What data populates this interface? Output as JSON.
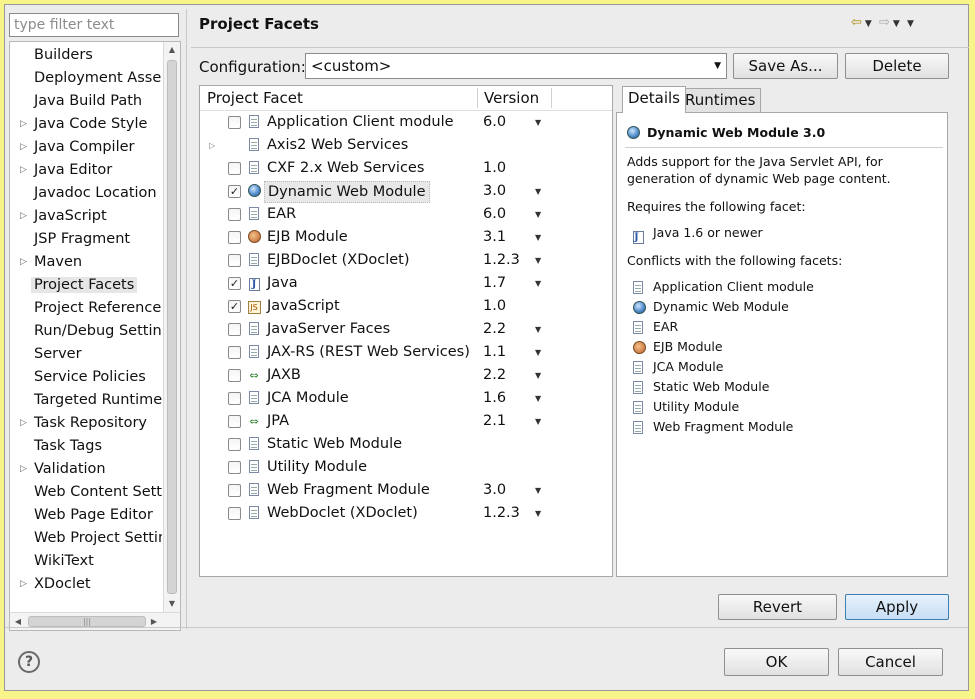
{
  "filter": {
    "placeholder": "type filter text"
  },
  "tree": {
    "items": [
      {
        "label": "Builders",
        "expandable": false
      },
      {
        "label": "Deployment Assembly",
        "expandable": false
      },
      {
        "label": "Java Build Path",
        "expandable": false
      },
      {
        "label": "Java Code Style",
        "expandable": true
      },
      {
        "label": "Java Compiler",
        "expandable": true
      },
      {
        "label": "Java Editor",
        "expandable": true
      },
      {
        "label": "Javadoc Location",
        "expandable": false
      },
      {
        "label": "JavaScript",
        "expandable": true
      },
      {
        "label": "JSP Fragment",
        "expandable": false
      },
      {
        "label": "Maven",
        "expandable": true
      },
      {
        "label": "Project Facets",
        "expandable": false,
        "selected": true
      },
      {
        "label": "Project References",
        "expandable": false
      },
      {
        "label": "Run/Debug Settings",
        "expandable": false
      },
      {
        "label": "Server",
        "expandable": false
      },
      {
        "label": "Service Policies",
        "expandable": false
      },
      {
        "label": "Targeted Runtimes",
        "expandable": false
      },
      {
        "label": "Task Repository",
        "expandable": true
      },
      {
        "label": "Task Tags",
        "expandable": false
      },
      {
        "label": "Validation",
        "expandable": true
      },
      {
        "label": "Web Content Settings",
        "expandable": false
      },
      {
        "label": "Web Page Editor",
        "expandable": false
      },
      {
        "label": "Web Project Settings",
        "expandable": false
      },
      {
        "label": "WikiText",
        "expandable": false
      },
      {
        "label": "XDoclet",
        "expandable": true
      }
    ]
  },
  "page": {
    "title": "Project Facets"
  },
  "configuration": {
    "label": "Configuration:",
    "value": "<custom>"
  },
  "buttons": {
    "save_as": "Save As...",
    "delete": "Delete",
    "revert": "Revert",
    "apply": "Apply",
    "ok": "OK",
    "cancel": "Cancel"
  },
  "facets": {
    "headers": {
      "facet": "Project Facet",
      "version": "Version"
    },
    "rows": [
      {
        "name": "Application Client module",
        "version": "6.0",
        "checked": false,
        "icon": "doc",
        "dropdown": true,
        "expandable": false
      },
      {
        "name": "Axis2 Web Services",
        "version": "",
        "checked": false,
        "icon": "doc",
        "dropdown": false,
        "expandable": true,
        "no_checkbox": true
      },
      {
        "name": "CXF 2.x Web Services",
        "version": "1.0",
        "checked": false,
        "icon": "doc",
        "dropdown": false,
        "expandable": false
      },
      {
        "name": "Dynamic Web Module",
        "version": "3.0",
        "checked": true,
        "icon": "globe",
        "dropdown": true,
        "expandable": false,
        "highlighted": true
      },
      {
        "name": "EAR",
        "version": "6.0",
        "checked": false,
        "icon": "doc",
        "dropdown": true,
        "expandable": false
      },
      {
        "name": "EJB Module",
        "version": "3.1",
        "checked": false,
        "icon": "bean",
        "dropdown": true,
        "expandable": false
      },
      {
        "name": "EJBDoclet (XDoclet)",
        "version": "1.2.3",
        "checked": false,
        "icon": "doc",
        "dropdown": true,
        "expandable": false
      },
      {
        "name": "Java",
        "version": "1.7",
        "checked": true,
        "icon": "java",
        "dropdown": true,
        "expandable": false
      },
      {
        "name": "JavaScript",
        "version": "1.0",
        "checked": true,
        "icon": "js",
        "dropdown": false,
        "expandable": false
      },
      {
        "name": "JavaServer Faces",
        "version": "2.2",
        "checked": false,
        "icon": "doc",
        "dropdown": true,
        "expandable": false
      },
      {
        "name": "JAX-RS (REST Web Services)",
        "version": "1.1",
        "checked": false,
        "icon": "doc",
        "dropdown": true,
        "expandable": false
      },
      {
        "name": "JAXB",
        "version": "2.2",
        "checked": false,
        "icon": "arrows",
        "dropdown": true,
        "expandable": false
      },
      {
        "name": "JCA Module",
        "version": "1.6",
        "checked": false,
        "icon": "doc",
        "dropdown": true,
        "expandable": false
      },
      {
        "name": "JPA",
        "version": "2.1",
        "checked": false,
        "icon": "arrows",
        "dropdown": true,
        "expandable": false
      },
      {
        "name": "Static Web Module",
        "version": "",
        "checked": false,
        "icon": "doc",
        "dropdown": false,
        "expandable": false
      },
      {
        "name": "Utility Module",
        "version": "",
        "checked": false,
        "icon": "doc",
        "dropdown": false,
        "expandable": false
      },
      {
        "name": "Web Fragment Module",
        "version": "3.0",
        "checked": false,
        "icon": "doc",
        "dropdown": true,
        "expandable": false
      },
      {
        "name": "WebDoclet (XDoclet)",
        "version": "1.2.3",
        "checked": false,
        "icon": "doc",
        "dropdown": true,
        "expandable": false
      }
    ]
  },
  "tabs": {
    "details": "Details",
    "runtimes": "Runtimes"
  },
  "details": {
    "heading": "Dynamic Web Module 3.0",
    "description": "Adds support for the Java Servlet API, for generation of dynamic Web page content.",
    "requires_label": "Requires the following facet:",
    "requires": [
      {
        "name": "Java 1.6 or newer",
        "icon": "java"
      }
    ],
    "conflicts_label": "Conflicts with the following facets:",
    "conflicts": [
      {
        "name": "Application Client module",
        "icon": "doc"
      },
      {
        "name": "Dynamic Web Module",
        "icon": "globe"
      },
      {
        "name": "EAR",
        "icon": "doc"
      },
      {
        "name": "EJB Module",
        "icon": "bean"
      },
      {
        "name": "JCA Module",
        "icon": "doc"
      },
      {
        "name": "Static Web Module",
        "icon": "doc"
      },
      {
        "name": "Utility Module",
        "icon": "doc"
      },
      {
        "name": "Web Fragment Module",
        "icon": "doc"
      }
    ]
  },
  "icons": {
    "help": "?"
  },
  "colors": {
    "background": "#f7f48a",
    "window": "#ececec",
    "accent": "#3c7fb1"
  }
}
